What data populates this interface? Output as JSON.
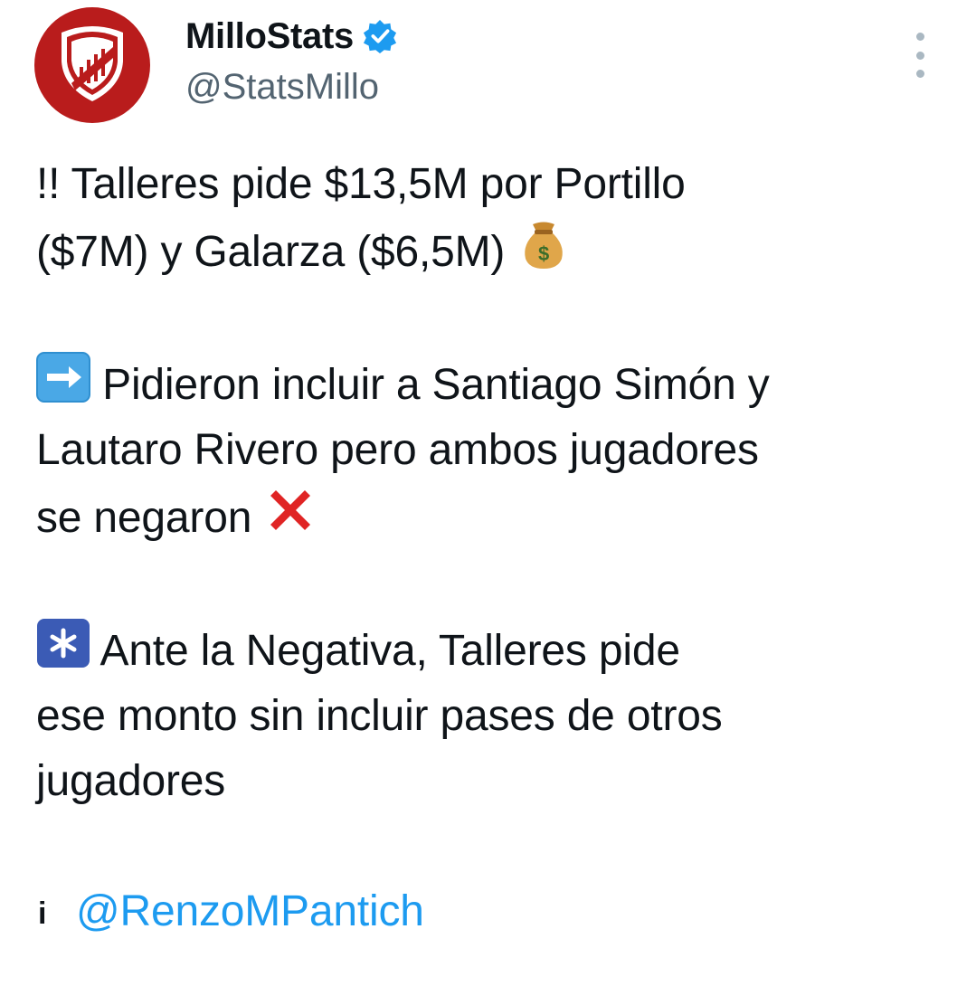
{
  "author": {
    "display_name": "MilloStats",
    "handle": "@StatsMillo",
    "verified": true,
    "avatar_icon": "river-plate-crest-icon",
    "avatar_color": "#b91c1c",
    "verified_color": "#1d9bf0"
  },
  "menu": {
    "icon": "more-options-icon"
  },
  "tweet": {
    "line1": "!! Talleres pide $13,5M por Portillo",
    "line2": "($7M) y Galarza ($6,5M)",
    "emoji_money_bag": "money-bag-icon",
    "line3": "Pidieron incluir a Santiago Simón y",
    "emoji_right_arrow": "right-arrow-icon",
    "line4": "Lautaro Rivero pero ambos jugadores",
    "line5": "se negaron",
    "emoji_cross": "cross-mark-icon",
    "line6": "Ante la Negativa, Talleres pide",
    "emoji_asterisk": "asterisk-icon",
    "line7": "ese monto sin incluir pases de otros",
    "line8": "jugadores",
    "source_glyph": "i",
    "mention": "@RenzoMPantich"
  },
  "colors": {
    "text": "#0f1419",
    "secondary": "#536471",
    "link": "#1d9bf0"
  }
}
